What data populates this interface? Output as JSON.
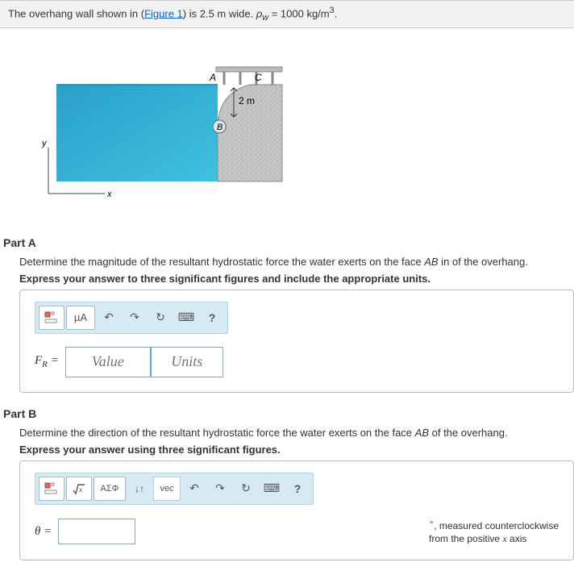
{
  "problem": {
    "pre_text": "The overhang wall shown in (",
    "figure_link": "Figure 1",
    "post_text_1": ") is 2.5  m wide. ",
    "rho_var": "ρ",
    "rho_sub": "w",
    "post_text_2": " = 1000 kg/m",
    "exp": "3",
    "period": "."
  },
  "figure": {
    "label_A": "A",
    "label_B": "B",
    "label_C": "C",
    "dim_2m": "2 m",
    "axis_x": "x",
    "axis_y": "y"
  },
  "partA": {
    "heading": "Part A",
    "question_pre": "Determine the magnitude of the resultant hydrostatic force the water exerts on the face ",
    "face": "AB",
    "question_post": " in of the overhang.",
    "instruction": "Express your answer to three significant figures and include the appropriate units.",
    "var_label": "F",
    "var_sub": "R",
    "eq": " = ",
    "value_ph": "Value",
    "units_ph": "Units",
    "toolbar": {
      "templates_label": "templates-icon",
      "units_btn": "µA",
      "undo": "↶",
      "redo": "↷",
      "reset": "↻",
      "keyboard": "⌨",
      "help": "?"
    }
  },
  "partB": {
    "heading": "Part B",
    "question_pre": "Determine the direction of the resultant hydrostatic force the water exerts on the face ",
    "face": "AB",
    "question_post": " of the overhang.",
    "instruction": "Express your answer using three significant figures.",
    "var_label": "θ",
    "eq": " = ",
    "suffix_deg": "∘",
    "suffix_pre": ", measured counterclockwise",
    "suffix_line2a": "from the positive ",
    "suffix_axis": "x",
    "suffix_line2b": " axis",
    "toolbar": {
      "greek": "ΑΣΦ",
      "updown": "↓↑",
      "vec": "vec",
      "undo": "↶",
      "redo": "↷",
      "reset": "↻",
      "keyboard": "⌨",
      "help": "?"
    }
  }
}
